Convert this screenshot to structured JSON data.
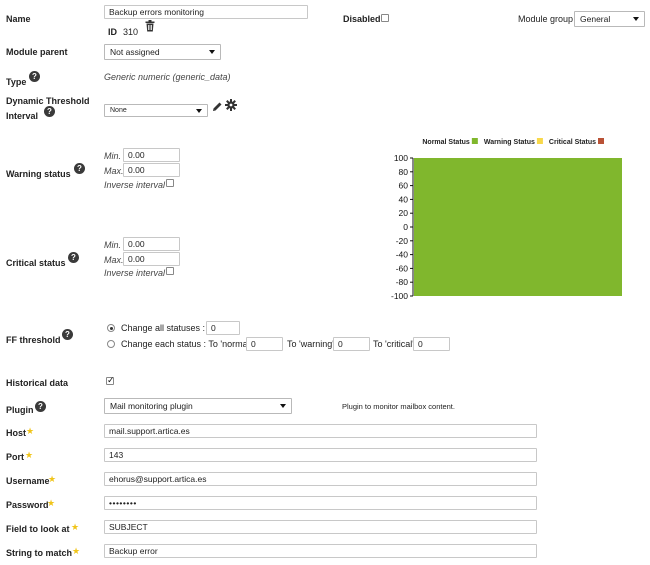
{
  "name": {
    "label": "Name",
    "value": "Backup errors monitoring",
    "id_label": "ID",
    "id_value": "310"
  },
  "disabled": {
    "label": "Disabled",
    "checked": false
  },
  "module_group": {
    "label": "Module group",
    "value": "General"
  },
  "module_parent": {
    "label": "Module parent",
    "value": "Not assigned"
  },
  "type": {
    "label": "Type",
    "value": "Generic numeric (generic_data)"
  },
  "dynamic_threshold": {
    "label_line1": "Dynamic Threshold",
    "label_line2": "Interval",
    "value": "None"
  },
  "warning": {
    "label": "Warning status",
    "min_label": "Min.",
    "min": "0.00",
    "max_label": "Max.",
    "max": "0.00",
    "inverse_label": "Inverse interval"
  },
  "critical": {
    "label": "Critical status",
    "min_label": "Min.",
    "min": "0.00",
    "max_label": "Max.",
    "max": "0.00",
    "inverse_label": "Inverse interval"
  },
  "ff_threshold": {
    "label": "FF threshold",
    "all_label": "Change all statuses :",
    "all_value": "0",
    "each_label": "Change each status : To 'normal'",
    "normal_value": "0",
    "warning_label": "To 'warning'",
    "warning_value": "0",
    "critical_label": "To 'critical'",
    "critical_value": "0"
  },
  "historical": {
    "label": "Historical data",
    "checked": true
  },
  "plugin": {
    "label": "Plugin",
    "value": "Mail monitoring plugin",
    "description": "Plugin to monitor mailbox content."
  },
  "fields": [
    {
      "label": "Host",
      "value": "mail.support.artica.es"
    },
    {
      "label": "Port",
      "value": "143"
    },
    {
      "label": "Username",
      "value": "ehorus@support.artica.es"
    },
    {
      "label": "Password",
      "value": "••••••••"
    },
    {
      "label": "Field to look at",
      "value": "SUBJECT"
    },
    {
      "label": "String to match",
      "value": "Backup error"
    }
  ],
  "colors": {
    "normal": "#80b72d",
    "warning": "#f8d84a",
    "critical": "#b95236",
    "help_icon": "#3a3a3a",
    "required_star": "#f0c419"
  },
  "chart_data": {
    "type": "area",
    "legend": [
      {
        "name": "Normal Status",
        "color": "#80b72d"
      },
      {
        "name": "Warning Status",
        "color": "#f8d84a"
      },
      {
        "name": "Critical Status",
        "color": "#b95236"
      }
    ],
    "legend_placement": "top-right",
    "ylim": [
      -100,
      100
    ],
    "yticks": [
      "100",
      "80",
      "60",
      "40",
      "20",
      "0",
      "-20",
      "-40",
      "-60",
      "-80",
      "-100"
    ],
    "bands": [
      {
        "status": "normal",
        "from": -100,
        "to": 100
      }
    ],
    "grid": false
  }
}
